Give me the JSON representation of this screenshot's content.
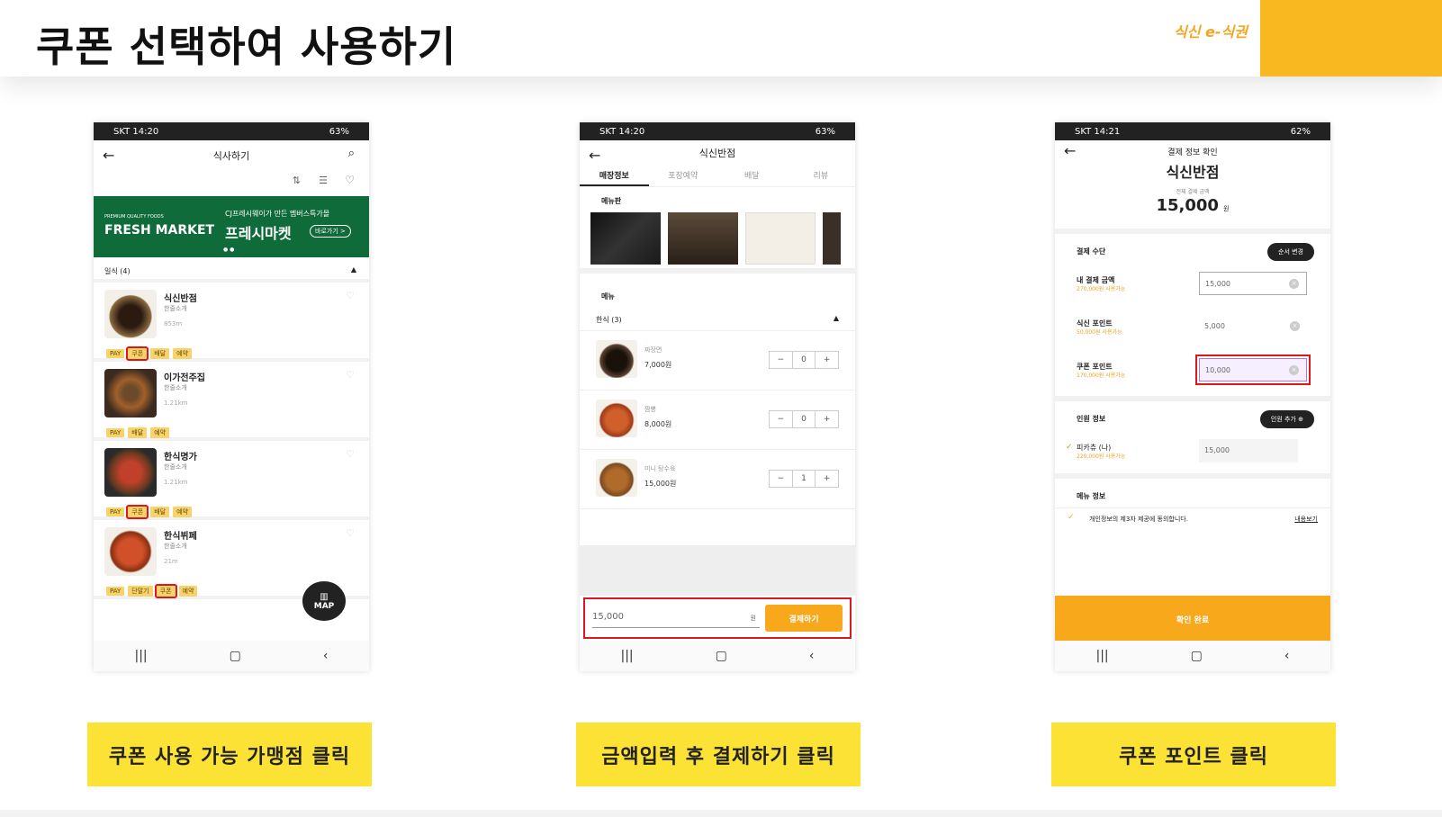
{
  "page": {
    "title": "쿠폰 선택하여 사용하기",
    "brand": "식신 e-식권"
  },
  "captions": [
    "쿠폰 사용 가능 가맹점 클릭",
    "금액입력 후 결제하기 클릭",
    "쿠폰 포인트 클릭"
  ],
  "phone1": {
    "status_left": "SKT 14:20",
    "status_right": "63%",
    "title": "식사하기",
    "banner": {
      "small": "PREMIUM QUALITY FOODS",
      "big": "FRESH MARKET",
      "line1": "CJ프레시웨이가 만든 멤버스특가몰",
      "line2": "프레시마켓",
      "btn": "바로가기 >"
    },
    "category": "일식 (4)",
    "stores": [
      {
        "name": "식신반점",
        "sub": "한줄소개",
        "dist": "853m",
        "tags": [
          "PAY",
          "쿠폰",
          "배달",
          "예약"
        ],
        "coupon_index": 1
      },
      {
        "name": "이가전주집",
        "sub": "한줄소개",
        "dist": "1.21km",
        "tags": [
          "PAY",
          "배달",
          "예약"
        ],
        "coupon_index": -1
      },
      {
        "name": "한식명가",
        "sub": "한줄소개",
        "dist": "1.21km",
        "tags": [
          "PAY",
          "쿠폰",
          "배달",
          "예약"
        ],
        "coupon_index": 1
      },
      {
        "name": "한식뷔페",
        "sub": "한줄소개",
        "dist": "21m",
        "tags": [
          "PAY",
          "단말기",
          "쿠폰",
          "예약"
        ],
        "coupon_index": 2
      }
    ],
    "map_label": "MAP"
  },
  "phone2": {
    "status_left": "SKT 14:20",
    "status_right": "63%",
    "title": "식신반점",
    "tabs": [
      "매장정보",
      "포장예약",
      "배달",
      "리뷰"
    ],
    "menuboard_label": "메뉴판",
    "menu_label": "메뉴",
    "category": "한식 (3)",
    "items": [
      {
        "name": "짜장면",
        "price": "7,000원",
        "qty": "0"
      },
      {
        "name": "짬뽕",
        "price": "8,000원",
        "qty": "0"
      },
      {
        "name": "미니 탕수육",
        "price": "15,000원",
        "qty": "1"
      }
    ],
    "amount": "15,000",
    "unit": "원",
    "pay_button": "결제하기"
  },
  "phone3": {
    "status_left": "SKT 14:21",
    "status_right": "62%",
    "title": "결제 정보 확인",
    "store": "식신반점",
    "total_label": "전체 결제 금액",
    "total": "15,000",
    "total_unit": "원",
    "pay_method_label": "결제 수단",
    "order_change": "순서 변경",
    "fields": [
      {
        "label": "내 결제 금액",
        "sub": "270,000원 사용가능",
        "value": "15,000"
      },
      {
        "label": "식신 포인트",
        "sub": "50,000원 사용가능",
        "value": "5,000"
      },
      {
        "label": "쿠폰 포인트",
        "sub": "170,000원 사용가능",
        "value": "10,000"
      }
    ],
    "people_label": "인원 정보",
    "add_people": "인원 추가",
    "person": {
      "name": "피카츄 (나)",
      "sub": "220,000원 사용가능",
      "value": "15,000"
    },
    "menu_info": "메뉴 정보",
    "agree": "개인정보의 제3자 제공에 동의합니다.",
    "view": "내용보기",
    "confirm": "확인 완료"
  }
}
